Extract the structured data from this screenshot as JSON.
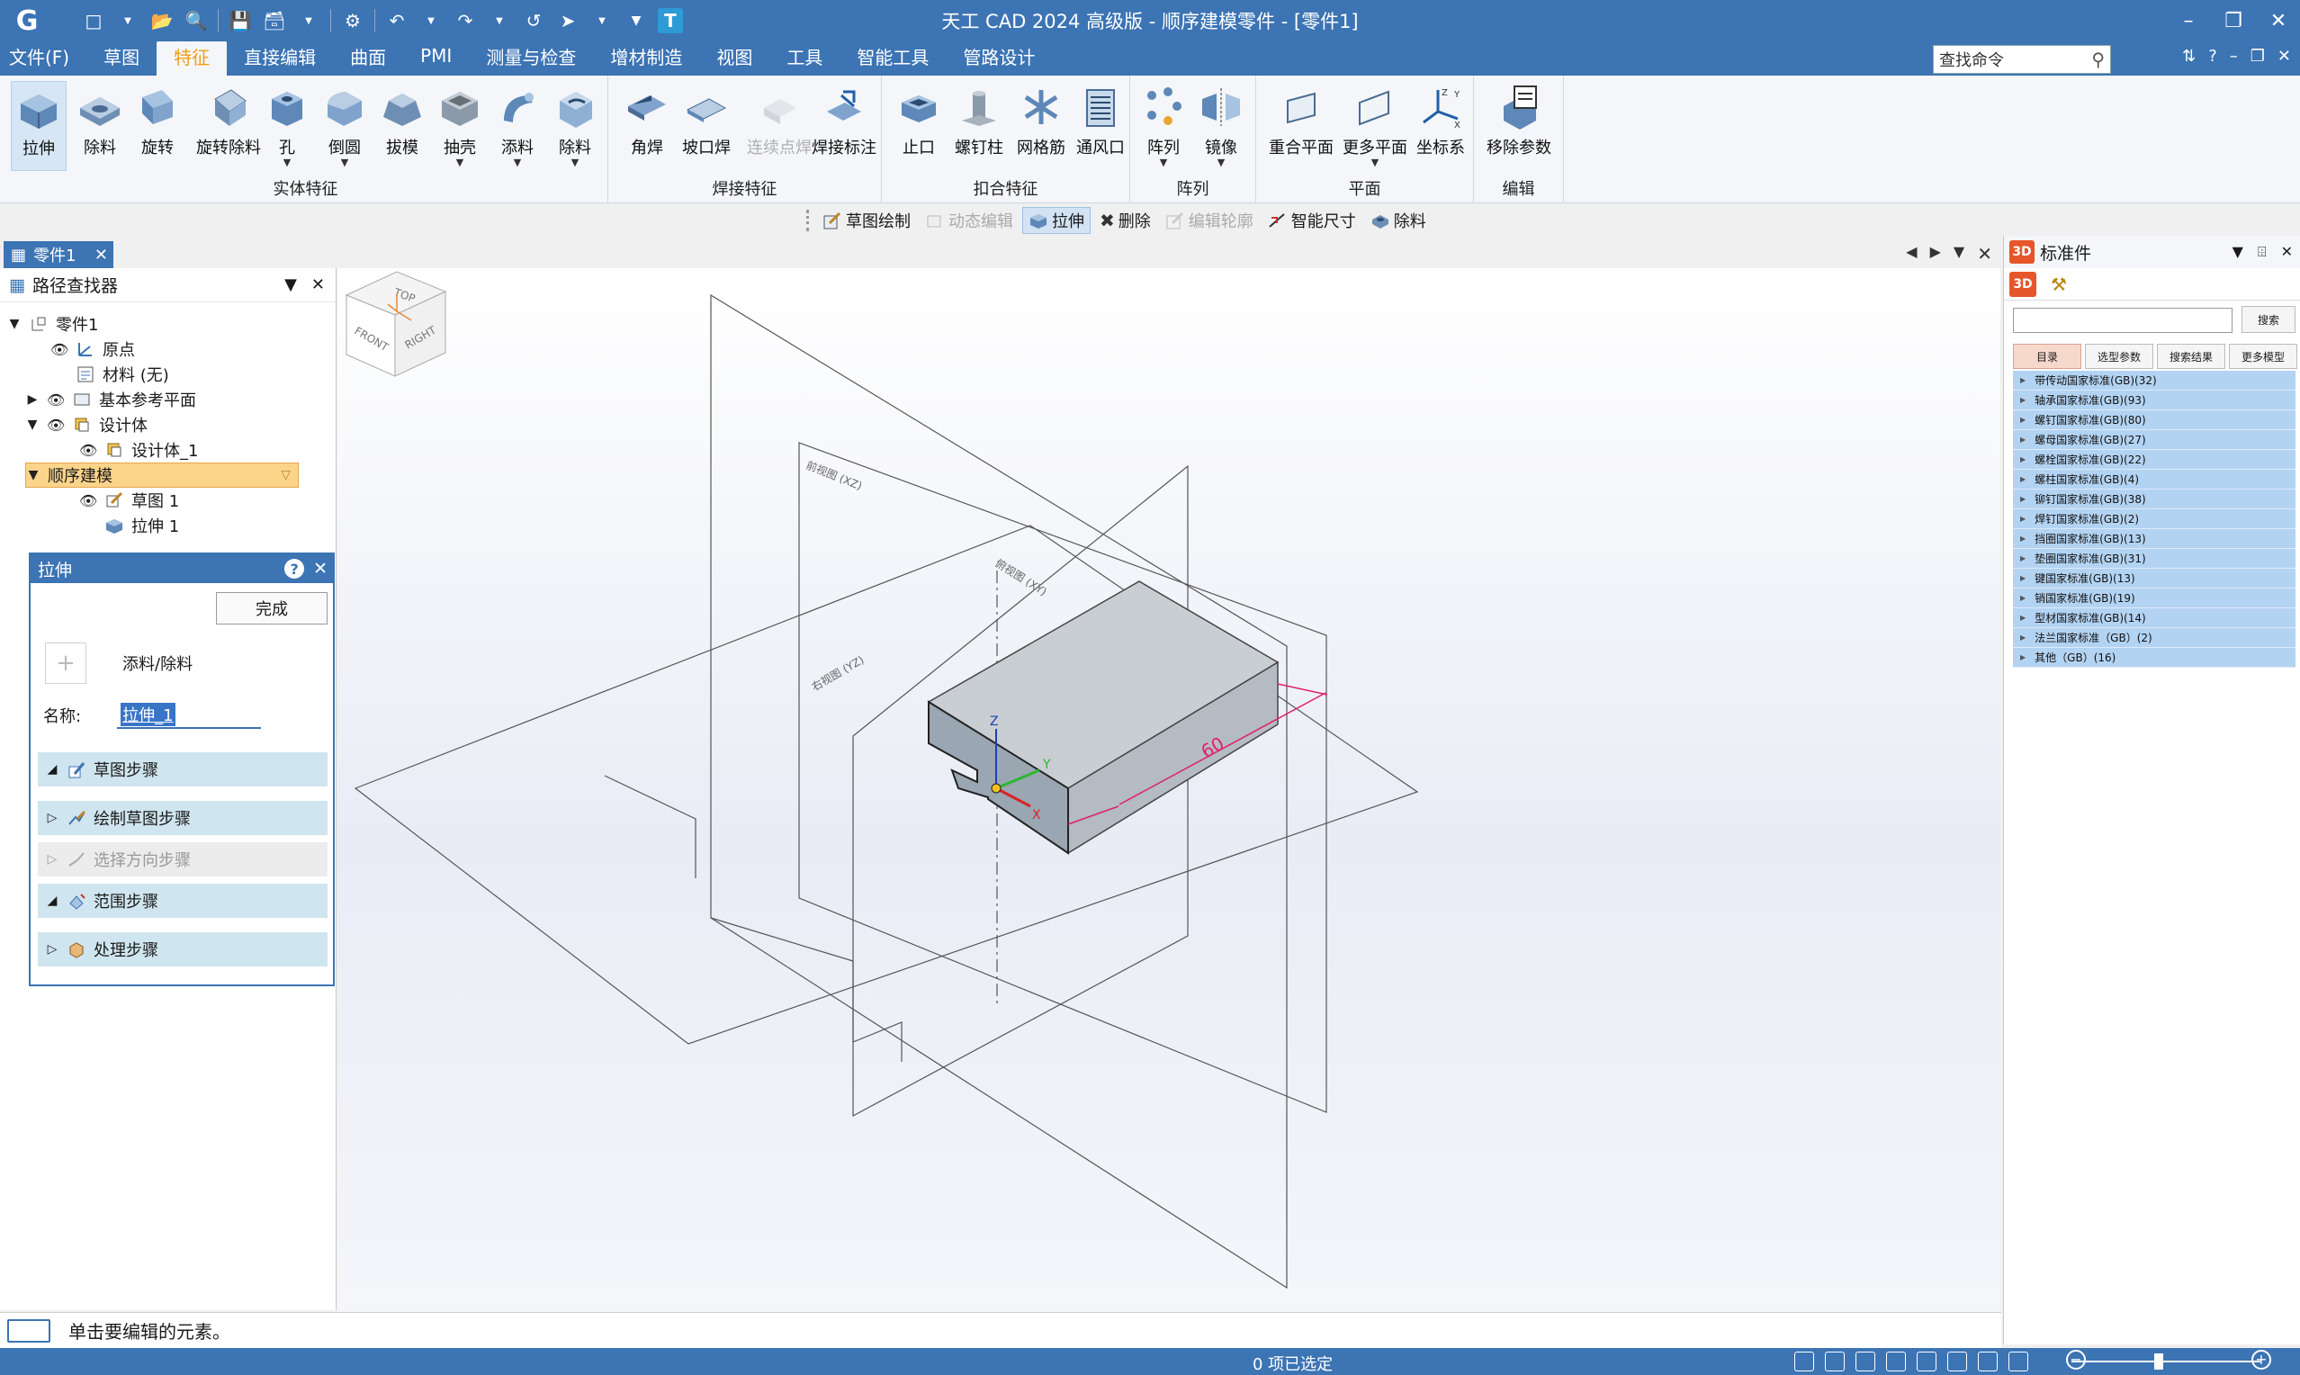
{
  "app": {
    "title": "天工 CAD 2024 高级版 - 顺序建模零件 - [零件1]"
  },
  "menu": {
    "tabs": [
      "文件(F)",
      "草图",
      "特征",
      "直接编辑",
      "曲面",
      "PMI",
      "测量与检查",
      "增材制造",
      "视图",
      "工具",
      "智能工具",
      "管路设计"
    ],
    "active": "特征",
    "search_placeholder": "查找命令"
  },
  "ribbon": {
    "groups": [
      {
        "label": "实体特征",
        "buttons": [
          "拉伸",
          "除料",
          "旋转",
          "旋转除料",
          "孔",
          "倒圆",
          "拔模",
          "抽壳",
          "添料",
          "除料"
        ]
      },
      {
        "label": "焊接特征",
        "buttons": [
          "角焊",
          "坡口焊",
          "连续点焊",
          "焊接标注"
        ]
      },
      {
        "label": "扣合特征",
        "buttons": [
          "止口",
          "螺钉柱",
          "网格筋",
          "通风口"
        ]
      },
      {
        "label": "阵列",
        "buttons": [
          "阵列",
          "镜像"
        ]
      },
      {
        "label": "平面",
        "buttons": [
          "重合平面",
          "更多平面",
          "坐标系"
        ]
      },
      {
        "label": "编辑",
        "buttons": [
          "移除参数"
        ]
      }
    ]
  },
  "commandbar": {
    "items": [
      "草图绘制",
      "动态编辑",
      "拉伸",
      "删除",
      "编辑轮廓",
      "智能尺寸",
      "除料"
    ]
  },
  "document": {
    "tab": "零件1"
  },
  "pathfinder": {
    "title": "路径查找器",
    "items": [
      "零件1",
      "原点",
      "材料 (无)",
      "基本参考平面",
      "设计体",
      "设计体_1",
      "顺序建模",
      "草图 1",
      "拉伸 1"
    ]
  },
  "extrude": {
    "title": "拉伸",
    "done": "完成",
    "add_remove": "添料/除料",
    "name_label": "名称:",
    "name_value": "拉伸_1",
    "steps": [
      "草图步骤",
      "绘制草图步骤",
      "选择方向步骤",
      "范围步骤",
      "处理步骤"
    ]
  },
  "viewport": {
    "dimension": "60",
    "plane_labels": [
      "前视图 (XZ)",
      "俯视图 (XY)",
      "右视图 (YZ)"
    ],
    "axis_labels": [
      "Z",
      "Y",
      "X"
    ],
    "viewcube": [
      "TOP",
      "FRONT",
      "RIGHT"
    ]
  },
  "stdparts": {
    "title": "标准件",
    "search_btn": "搜索",
    "subtabs": [
      "目录",
      "选型参数",
      "搜索结果",
      "更多模型"
    ],
    "items": [
      "带传动国家标准(GB)(32)",
      "轴承国家标准(GB)(93)",
      "螺钉国家标准(GB)(80)",
      "螺母国家标准(GB)(27)",
      "螺栓国家标准(GB)(22)",
      "螺柱国家标准(GB)(4)",
      "铆钉国家标准(GB)(38)",
      "焊钉国家标准(GB)(2)",
      "挡圈国家标准(GB)(13)",
      "垫圈国家标准(GB)(31)",
      "键国家标准(GB)(13)",
      "销国家标准(GB)(19)",
      "型材国家标准(GB)(14)",
      "法兰国家标准（GB）(2)",
      "其他（GB）(16)"
    ]
  },
  "status": {
    "prompt": "单击要编辑的元素。",
    "selection": "0 项已选定"
  }
}
